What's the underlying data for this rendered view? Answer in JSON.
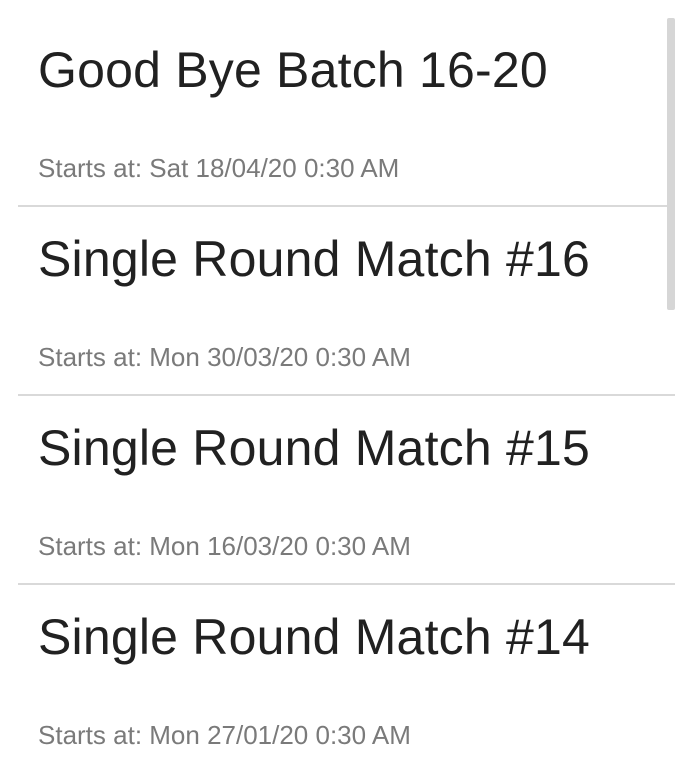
{
  "matches": [
    {
      "title": "Good Bye Batch 16-20",
      "starts": "Starts at: Sat 18/04/20 0:30 AM"
    },
    {
      "title": "Single Round Match #16",
      "starts": "Starts at: Mon 30/03/20 0:30 AM"
    },
    {
      "title": "Single Round Match #15",
      "starts": "Starts at: Mon 16/03/20 0:30 AM"
    },
    {
      "title": "Single Round Match #14",
      "starts": "Starts at: Mon 27/01/20 0:30 AM"
    }
  ]
}
